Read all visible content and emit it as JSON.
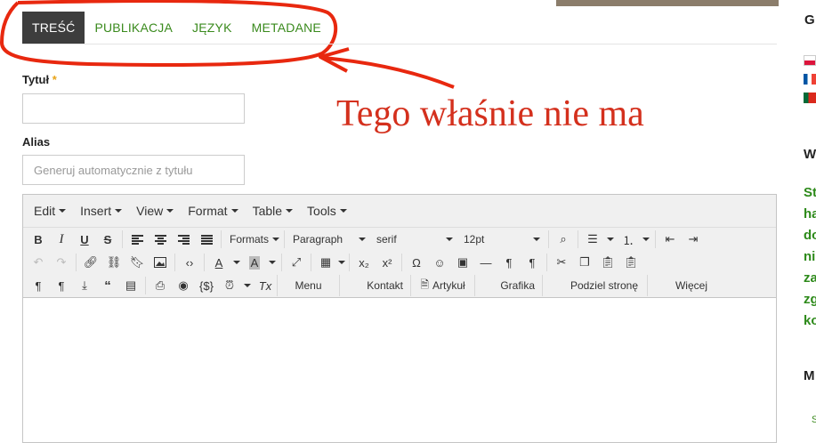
{
  "tabs": [
    {
      "label": "TREŚĆ",
      "active": true
    },
    {
      "label": "PUBLIKACJA",
      "active": false
    },
    {
      "label": "JĘZYK",
      "active": false
    },
    {
      "label": "METADANE",
      "active": false
    }
  ],
  "form": {
    "title_label": "Tytuł",
    "required_mark": "*",
    "title_value": "",
    "alias_label": "Alias",
    "alias_placeholder": "Generuj automatycznie z tytułu"
  },
  "editor": {
    "menus": [
      "Edit",
      "Insert",
      "View",
      "Format",
      "Table",
      "Tools"
    ],
    "formats_label": "Formats",
    "block_format": "Paragraph",
    "font_family": "serif",
    "font_size": "12pt",
    "custom_buttons": [
      "Menu",
      "Kontakt",
      "Artykuł",
      "Grafika",
      "Podziel stronę",
      "Więcej"
    ]
  },
  "annotation": {
    "text": "Tego właśnie nie ma",
    "color": "#d4301d"
  },
  "sidebar_fragments": {
    "heading_g": "G",
    "heading_w": "W",
    "lines": [
      "St",
      "ha",
      "do",
      "ni",
      "za",
      "zg",
      "ko"
    ],
    "heading_m": "M",
    "small_s": "S"
  },
  "colors": {
    "tab_active_bg": "#3d3d3d",
    "link_green": "#3a8a1d",
    "toolbar_bg": "#f0f0f0"
  }
}
